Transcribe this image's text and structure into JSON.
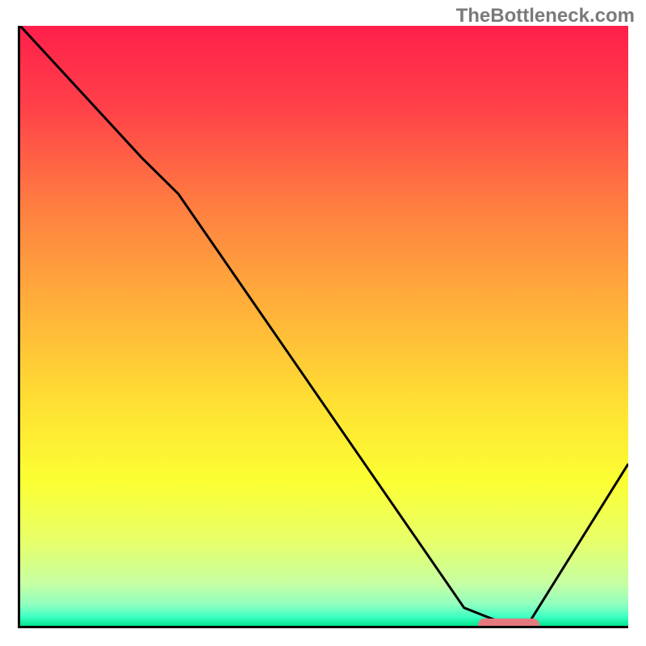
{
  "watermark": "TheBottleneck.com",
  "chart_data": {
    "type": "line",
    "title": "",
    "xlabel": "",
    "ylabel": "",
    "xlim": [
      0,
      100
    ],
    "ylim": [
      0,
      100
    ],
    "series": [
      {
        "name": "curve",
        "x": [
          0,
          20,
          26,
          73,
          78,
          84,
          100
        ],
        "y": [
          100,
          78,
          72,
          3,
          1,
          1,
          27
        ]
      }
    ],
    "marker": {
      "x_start": 75,
      "x_end": 85,
      "y": 0.5
    },
    "gradient_stops": [
      {
        "pos": 0.0,
        "color": "#ff1f4b"
      },
      {
        "pos": 0.14,
        "color": "#ff4249"
      },
      {
        "pos": 0.3,
        "color": "#ff7e41"
      },
      {
        "pos": 0.48,
        "color": "#ffb43a"
      },
      {
        "pos": 0.63,
        "color": "#ffe033"
      },
      {
        "pos": 0.76,
        "color": "#fbff33"
      },
      {
        "pos": 0.86,
        "color": "#e7ff6a"
      },
      {
        "pos": 0.93,
        "color": "#c6ffa3"
      },
      {
        "pos": 0.965,
        "color": "#8effc0"
      },
      {
        "pos": 0.985,
        "color": "#3effc2"
      },
      {
        "pos": 1.0,
        "color": "#00e58f"
      }
    ]
  }
}
